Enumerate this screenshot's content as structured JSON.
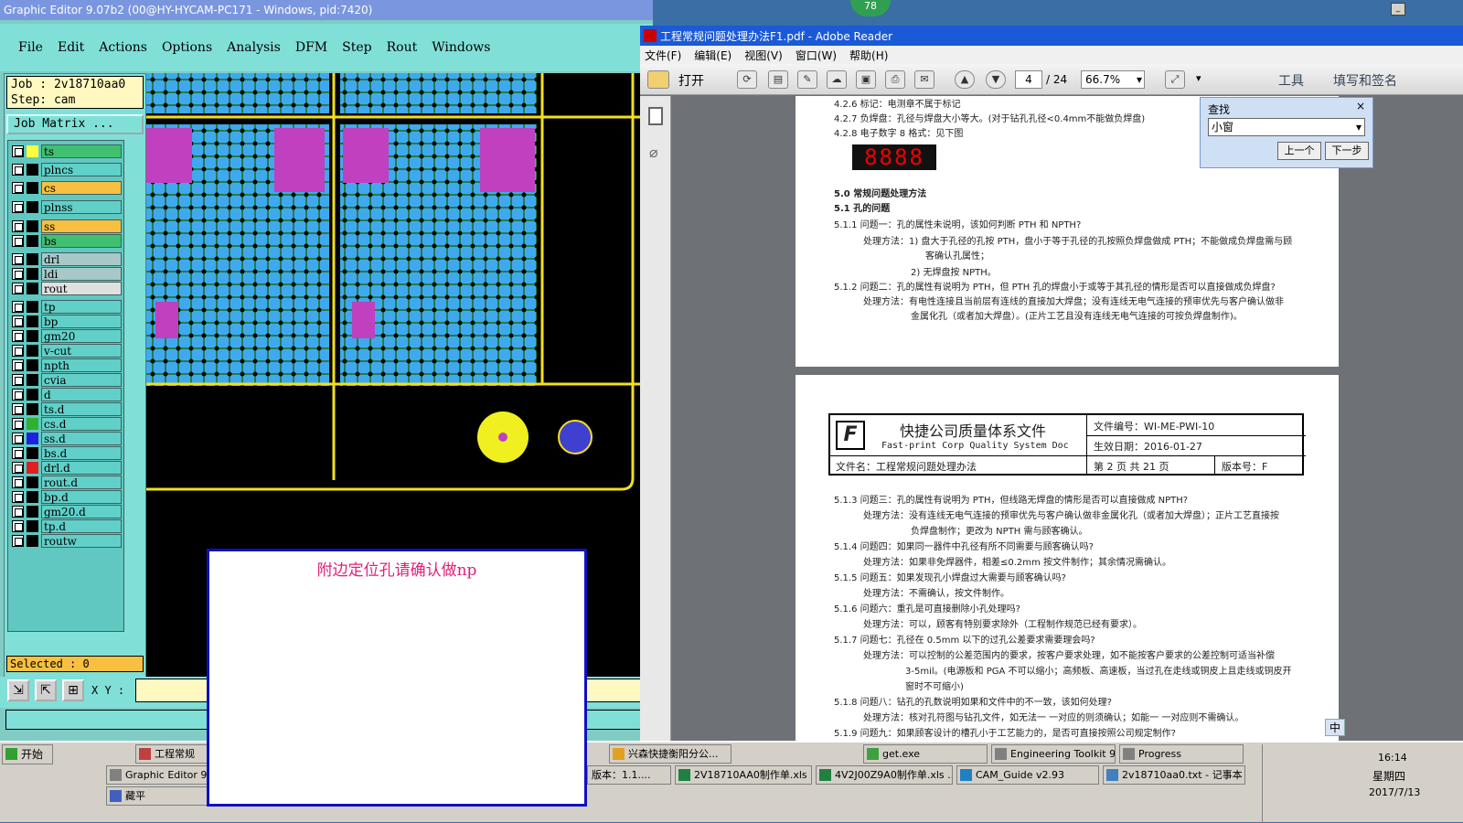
{
  "badge": "78",
  "editor": {
    "title": "Graphic Editor 9.07b2 (00@HY-HYCAM-PC171 - Windows, pid:7420)",
    "menu": [
      "File",
      "Edit",
      "Actions",
      "Options",
      "Analysis",
      "DFM",
      "Step",
      "Rout",
      "Windows"
    ],
    "job": "Job : 2v18710aa0",
    "step": "Step: cam",
    "job_matrix": "Job Matrix ...",
    "layers": [
      {
        "name": "ts",
        "swatch": "#ffff40",
        "bg": "#40c070"
      },
      {
        "name": "plncs",
        "swatch": "#000000",
        "bg": "#60d0c8"
      },
      {
        "name": "cs",
        "swatch": "#000000",
        "bg": "#f8c040"
      },
      {
        "name": "plnss",
        "swatch": "#000000",
        "bg": "#60d0c8"
      },
      {
        "name": "ss",
        "swatch": "#000000",
        "bg": "#f8c040"
      },
      {
        "name": "bs",
        "swatch": "#000000",
        "bg": "#40c070"
      },
      {
        "name": "drl",
        "swatch": "#000000",
        "bg": "#a8c8c8"
      },
      {
        "name": "ldi",
        "swatch": "#000000",
        "bg": "#a8c8c8"
      },
      {
        "name": "rout",
        "swatch": "#000000",
        "bg": "#e0e0e0"
      },
      {
        "name": "tp",
        "swatch": "#000000",
        "bg": "#60d0c8"
      },
      {
        "name": "bp",
        "swatch": "#000000",
        "bg": "#60d0c8"
      },
      {
        "name": "gm20",
        "swatch": "#000000",
        "bg": "#60d0c8"
      },
      {
        "name": "v-cut",
        "swatch": "#000000",
        "bg": "#60d0c8"
      },
      {
        "name": "npth",
        "swatch": "#000000",
        "bg": "#60d0c8"
      },
      {
        "name": "cvia",
        "swatch": "#000000",
        "bg": "#60d0c8"
      },
      {
        "name": "d",
        "swatch": "#000000",
        "bg": "#60d0c8"
      },
      {
        "name": "ts.d",
        "swatch": "#000000",
        "bg": "#60d0c8"
      },
      {
        "name": "cs.d",
        "swatch": "#30b030",
        "bg": "#60d0c8"
      },
      {
        "name": "ss.d",
        "swatch": "#2020e0",
        "bg": "#60d0c8"
      },
      {
        "name": "bs.d",
        "swatch": "#000000",
        "bg": "#60d0c8"
      },
      {
        "name": "drl.d",
        "swatch": "#e02020",
        "bg": "#60d0c8"
      },
      {
        "name": "rout.d",
        "swatch": "#000000",
        "bg": "#60d0c8"
      },
      {
        "name": "bp.d",
        "swatch": "#000000",
        "bg": "#60d0c8"
      },
      {
        "name": "gm20.d",
        "swatch": "#000000",
        "bg": "#60d0c8"
      },
      {
        "name": "tp.d",
        "swatch": "#000000",
        "bg": "#60d0c8"
      },
      {
        "name": "routw",
        "swatch": "#000000",
        "bg": "#60d0c8"
      }
    ],
    "selected": "Selected : 0",
    "xy_label": "X Y :"
  },
  "popup": {
    "message": "附边定位孔请确认做np"
  },
  "reader": {
    "title": "工程常规问题处理办法F1.pdf - Adobe Reader",
    "menu": [
      "文件(F)",
      "编辑(E)",
      "视图(V)",
      "窗口(W)",
      "帮助(H)"
    ],
    "open_label": "打开",
    "page_current": "4",
    "page_total": "/ 24",
    "zoom": "66.7%",
    "tools_label": "工具",
    "sign_label": "填写和签名",
    "find": {
      "title": "查找",
      "value": "小窗",
      "prev": "上一个",
      "next": "下一步"
    },
    "seg_display": "8888",
    "page1_lines": [
      "4.2.6 标记：电测章不属于标记",
      "4.2.7 负焊盘：孔径与焊盘大小等大。(对于钻孔孔径<0.4mm不能做负焊盘)",
      "4.2.8 电子数字 8 格式：见下图",
      "5.0 常规问题处理方法",
      "5.1 孔的问题",
      "5.1.1 问题一：孔的属性未说明，该如何判断 PTH 和 NPTH?",
      "处理方法：1) 盘大于孔径的孔按 PTH，盘小于等于孔径的孔按照负焊盘做成 PTH；不能做成负焊盘需与顾",
      "客确认孔属性；",
      "2) 无焊盘按 NPTH。",
      "5.1.2 问题二：孔的属性有说明为 PTH，但 PTH 孔的焊盘小于或等于其孔径的情形是否可以直接做成负焊盘?",
      "处理方法：有电性连接且当前层有连线的直接加大焊盘；没有连线无电气连接的预审优先与客户确认做非",
      "金属化孔（或者加大焊盘）。(正片工艺且没有连线无电气连接的可按负焊盘制作)。"
    ],
    "header": {
      "company": "快捷公司质量体系文件",
      "company_en": "Fast-print Corp Quality System Doc",
      "doc_no": "文件编号：WI-ME-PWI-10",
      "date": "生效日期：2016-01-27",
      "filename": "文件名：工程常规问题处理办法",
      "page": "第 2 页 共 21 页",
      "version": "版本号：F"
    },
    "page2_lines": [
      "5.1.3 问题三：孔的属性有说明为 PTH，但线路无焊盘的情形是否可以直接做成 NPTH?",
      "处理方法：没有连线无电气连接的预审优先与客户确认做非金属化孔（或者加大焊盘）；正片工艺直接按",
      "负焊盘制作；更改为 NPTH 需与顾客确认。",
      "5.1.4 问题四：如果同一器件中孔径有所不同需要与顾客确认吗?",
      "处理方法：如果非免焊器件，相差≤0.2mm 按文件制作；其余情况需确认。",
      "5.1.5 问题五：如果发现孔小焊盘过大需要与顾客确认吗?",
      "处理方法：不需确认，按文件制作。",
      "5.1.6 问题六：重孔是可直接删除小孔处理吗?",
      "处理方法：可以，顾客有特别要求除外（工程制作规范已经有要求）。",
      "5.1.7 问题七：孔径在 0.5mm 以下的过孔公差要求需要理会吗?",
      "处理方法：可以控制的公差范围内的要求，按客户要求处理，如不能按客户要求的公差控制可适当补偿",
      "3-5mil。(电源板和 PGA 不可以缩小；高频板、高速板，当过孔在走线或铜皮上且走线或铜皮开",
      "窗时不可缩小)",
      "5.1.8 问题八：钻孔的孔数说明如果和文件中的不一致，该如何处理?",
      "处理方法：核对孔符图与钻孔文件，如无法一 一对应的则须确认；如能一 一对应则不需确认。",
      "5.1.9 问题九：如果顾客设计的槽孔小于工艺能力的，是否可直接按照公司规定制作?"
    ]
  },
  "taskbar": {
    "start": "开始",
    "row1": [
      "工程常规",
      "兴森快捷衡阳分公...",
      "get.exe",
      "Engineering Toolkit 9...",
      "Progress"
    ],
    "row2": [
      "Graphic Editor 9.07",
      "版本：1.1....",
      "2V18710AA0制作单.xls ...",
      "4V2J00Z9A0制作单.xls ...",
      "CAM_Guide v2.93",
      "2v18710aa0.txt - 记事本"
    ],
    "row3": [
      "藏平"
    ],
    "ime": "中",
    "clock": "16:14",
    "weekday": "星期四",
    "date": "2017/7/13"
  }
}
